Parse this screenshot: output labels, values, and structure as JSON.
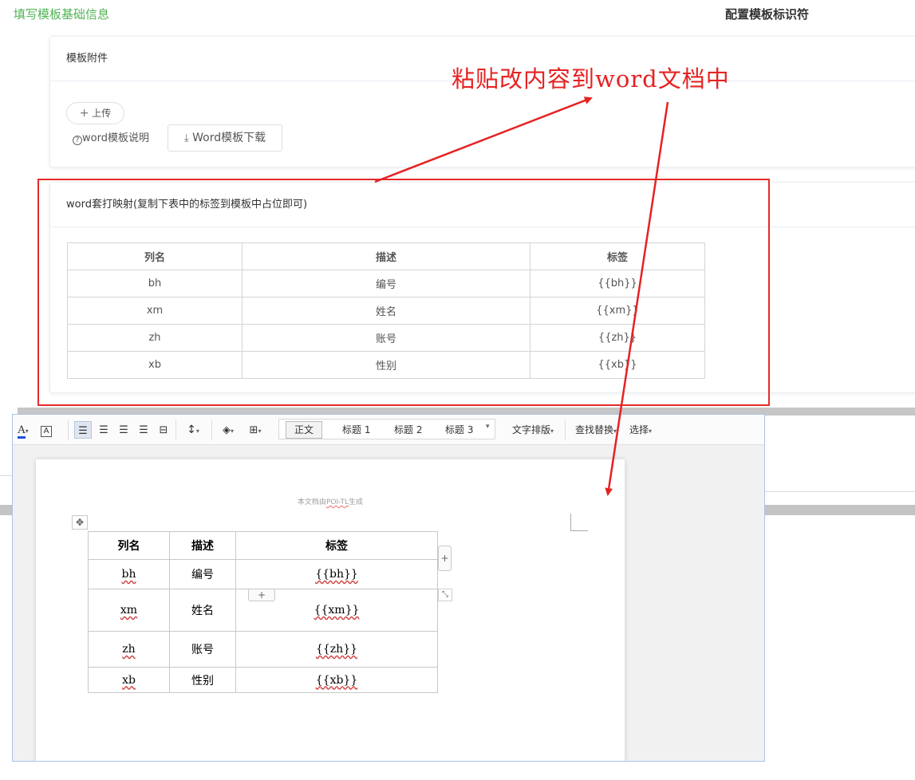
{
  "steps": {
    "step1": "填写模板基础信息",
    "step2": "配置模板标识符"
  },
  "attachment_card": {
    "title": "模板附件",
    "upload_label": "上传",
    "help_label": "word模板说明",
    "download_label": "Word模板下载"
  },
  "mapping_card": {
    "title": "word套打映射(复制下表中的标签到模板中占位即可)",
    "headers": [
      "列名",
      "描述",
      "标签"
    ],
    "rows": [
      [
        "bh",
        "编号",
        "{{bh}}"
      ],
      [
        "xm",
        "姓名",
        "{{xm}}"
      ],
      [
        "zh",
        "账号",
        "{{zh}}"
      ],
      [
        "xb",
        "性别",
        "{{xb}}"
      ]
    ]
  },
  "annotation": "粘贴改内容到word文档中",
  "colors": {
    "step_active": "#52b356",
    "annotation_red": "#e52222",
    "word_border": "#a9c3ea"
  },
  "word": {
    "styles": {
      "normal": "正文",
      "heading1": "标题 1",
      "heading2": "标题 2",
      "heading3": "标题 3"
    },
    "menu": {
      "layout": "文字排版",
      "find_replace": "查找替换",
      "select": "选择"
    },
    "page_header": "本文档由",
    "page_header_tool": "POI-TL",
    "page_header_tail": "生成",
    "table": {
      "headers": [
        "列名",
        "描述",
        "标签"
      ],
      "rows": [
        [
          "bh",
          "编号",
          "{{bh}}"
        ],
        [
          "xm",
          "姓名",
          "{{xm}}"
        ],
        [
          "zh",
          "账号",
          "{{zh}}"
        ],
        [
          "xb",
          "性别",
          "{{xb}}"
        ]
      ]
    }
  }
}
